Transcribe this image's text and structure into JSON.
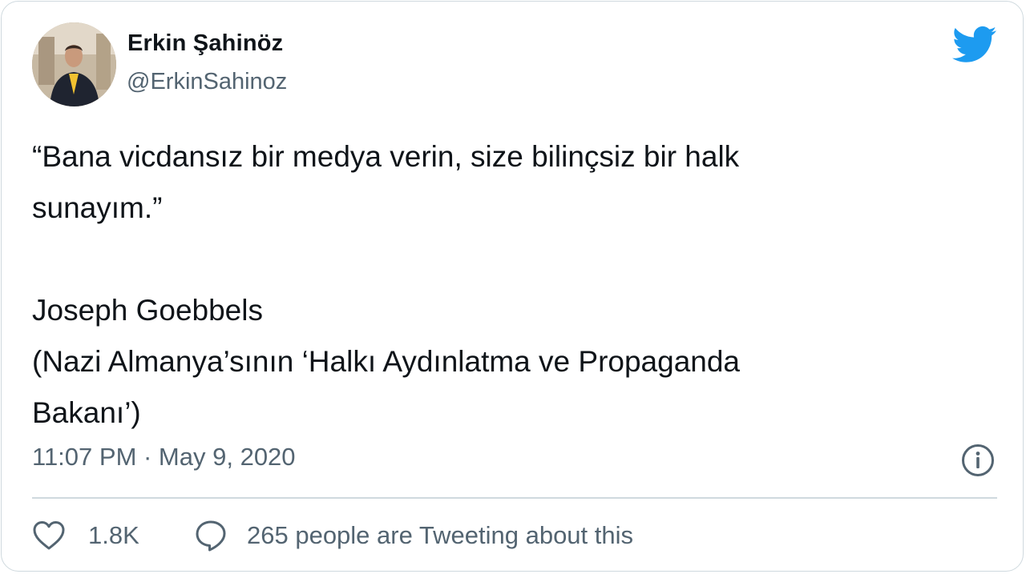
{
  "author": {
    "name": "Erkin Şahinöz",
    "handle": "@ErkinSahinoz"
  },
  "tweet": {
    "text_lines": [
      "“Bana vicdansız bir medya verin, size bilinçsiz bir halk",
      "sunayım.”",
      "Joseph Goebbels",
      "(Nazi Almanya’sının ‘Halkı Aydınlatma ve Propaganda",
      "Bakanı’)"
    ],
    "timestamp": "11:07 PM · May 9, 2020"
  },
  "actions": {
    "likes": "1.8K",
    "conversation": "265 people are Tweeting about this"
  },
  "icons": {
    "brand": "twitter-bird-icon",
    "info": "info-icon",
    "like": "heart-icon",
    "reply": "speech-bubble-icon"
  },
  "colors": {
    "brand_blue": "#1d9bf0",
    "muted_text": "#536471",
    "border": "#cfd9de"
  }
}
